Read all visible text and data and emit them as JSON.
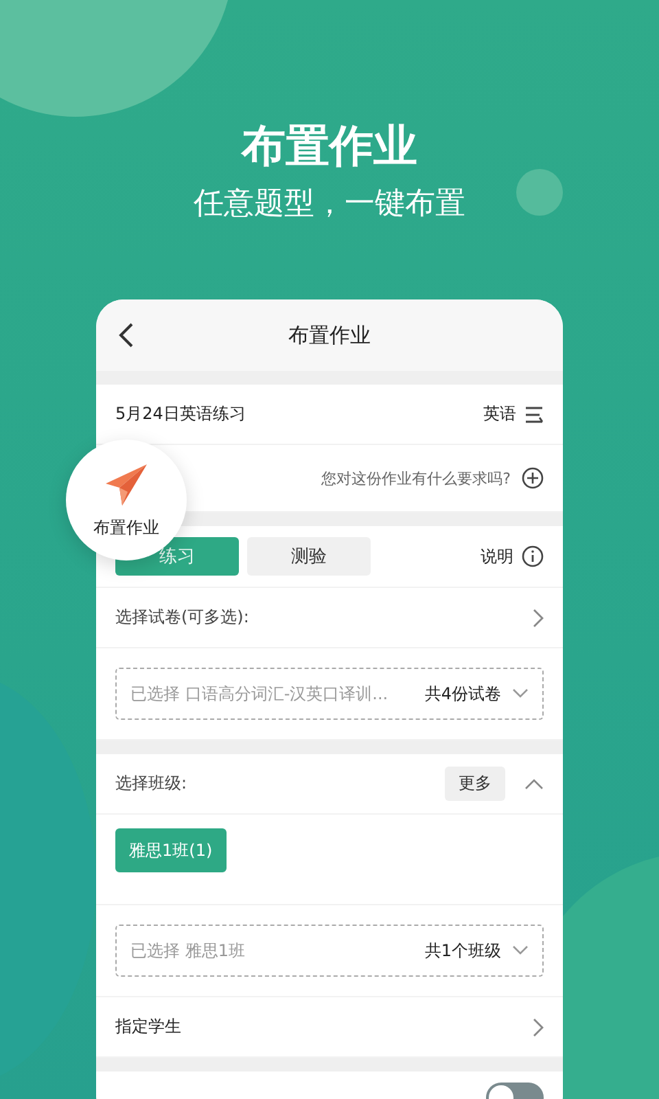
{
  "hero": {
    "title": "布置作业",
    "subtitle": "任意题型，一键布置"
  },
  "badge": {
    "label": "布置作业"
  },
  "screen": {
    "title": "布置作业",
    "name_row": {
      "name": "5月24日英语练习",
      "subject": "英语"
    },
    "requirement": {
      "placeholder": "您对这份作业有什么要求吗?"
    },
    "tabs": [
      {
        "label": "练习",
        "selected": true
      },
      {
        "label": "测验",
        "selected": false
      }
    ],
    "help_link": "说明",
    "paper_row": {
      "label": "选择试卷(可多选):"
    },
    "paper_select": {
      "value": "已选择 口语高分词汇-汉英口译训...",
      "count": "共4份试卷"
    },
    "class_row": {
      "label": "选择班级:",
      "more": "更多",
      "expanded": true
    },
    "classes": [
      {
        "label": "雅思1班(1)",
        "selected": true
      }
    ],
    "class_select": {
      "value": "已选择 雅思1班",
      "count": "共1个班级"
    },
    "student_row": {
      "label": "指定学生"
    },
    "toggle_row": {
      "on": false
    }
  }
}
